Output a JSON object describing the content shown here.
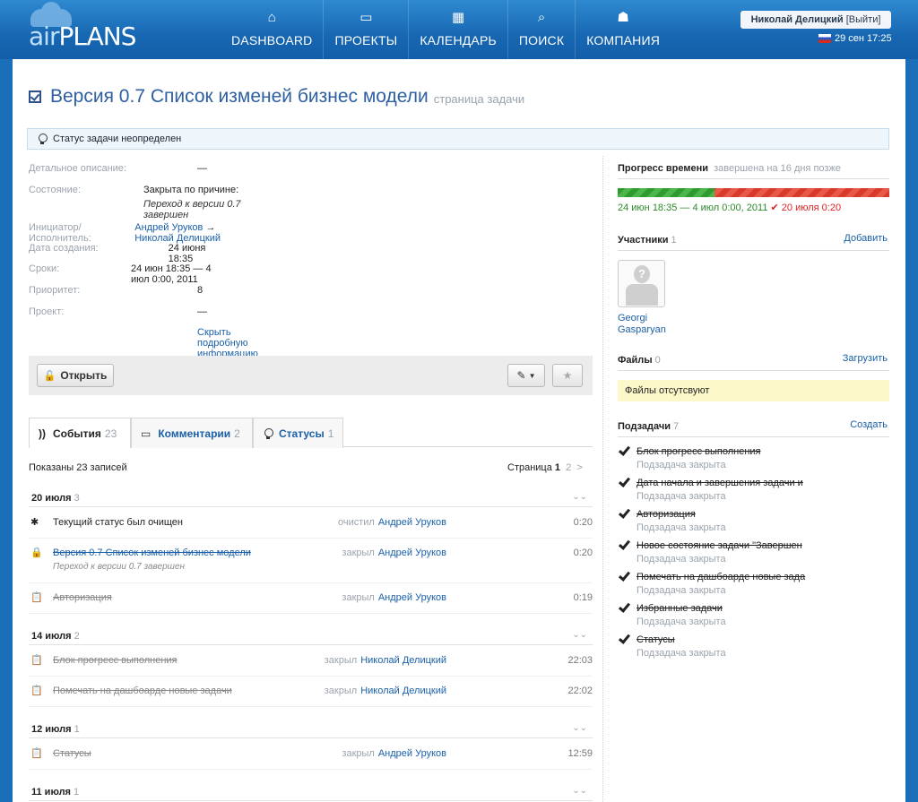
{
  "app": {
    "logo_air": "air",
    "logo_plans": "PLANS"
  },
  "nav": [
    {
      "label": "DASHBOARD",
      "icon": "home-icon"
    },
    {
      "label": "ПРОЕКТЫ",
      "icon": "monitor-icon"
    },
    {
      "label": "КАЛЕНДАРЬ",
      "icon": "calendar-icon"
    },
    {
      "label": "ПОИСК",
      "icon": "search-icon"
    },
    {
      "label": "КОМПАНИЯ",
      "icon": "people-icon"
    }
  ],
  "user": {
    "name": "Николай Делицкий",
    "logout": "[Выйти]",
    "datetime": "29 сен 17:25"
  },
  "task": {
    "title": "Версия 0.7 Список изменей бизнес модели",
    "subtitle": "страница задачи",
    "status": "Статус задачи неопределен"
  },
  "details": {
    "desc_label": "Детальное описание:",
    "desc_value": "—",
    "state_label": "Состояние:",
    "state_value": "Закрыта по причине:",
    "state_reason": "Переход к версии 0.7 завершен",
    "initiator_label": "Инициатор/Исполнитель:",
    "initiator": "Андрей Уруков",
    "arrow": "→",
    "executor": "Николай Делицкий",
    "created_label": "Дата создания:",
    "created_value": "24 июня 18:35",
    "terms_label": "Сроки:",
    "terms_value": "24 июн 18:35 — 4 июл 0:00, 2011",
    "priority_label": "Приоритет:",
    "priority_value": "8",
    "project_label": "Проект:",
    "project_value": "—",
    "hide_link": "Скрыть подробную информацию ↑"
  },
  "actions": {
    "open": "Открыть"
  },
  "tabs": [
    {
      "label": "События",
      "count": "23"
    },
    {
      "label": "Комментарии",
      "count": "2"
    },
    {
      "label": "Статусы",
      "count": "1"
    }
  ],
  "events": {
    "shown": "Показаны 23 записей",
    "page_label": "Страница",
    "page_current": "1",
    "page_next": "2",
    "page_arrow": ">",
    "groups": [
      {
        "date": "20 июля",
        "count": "3"
      },
      {
        "date": "14 июля",
        "count": "2"
      },
      {
        "date": "12 июля",
        "count": "1"
      },
      {
        "date": "11 июля",
        "count": "1"
      }
    ],
    "items": [
      {
        "text": "Текущий статус был очищен",
        "sub": "",
        "action": "очистил",
        "who": "Андрей Уруков",
        "time": "0:20"
      },
      {
        "text": "Версия 0.7 Список изменей бизнес модели",
        "sub": "Переход к версии 0.7 завершен",
        "action": "закрыл",
        "who": "Андрей Уруков",
        "time": "0:20"
      },
      {
        "text": "Авторизация",
        "sub": "",
        "action": "закрыл",
        "who": "Андрей Уруков",
        "time": "0:19"
      },
      {
        "text": "Блок прогресс выполнения",
        "sub": "",
        "action": "закрыл",
        "who": "Николай Делицкий",
        "time": "22:03"
      },
      {
        "text": "Помечать на дашбоарде новые задачи",
        "sub": "",
        "action": "закрыл",
        "who": "Николай Делицкий",
        "time": "22:02"
      },
      {
        "text": "Статусы",
        "sub": "",
        "action": "закрыл",
        "who": "Андрей Уруков",
        "time": "12:59"
      }
    ]
  },
  "right": {
    "time_title": "Прогресс времени",
    "time_note": "завершена на 16 дня позже",
    "time_range": "24 июн 18:35 — 4 июл 0:00, 2011",
    "time_done": "✔ 20 июля 0:20",
    "time_progress": 0.357,
    "participants_title": "Участники",
    "participants_count": "1",
    "participants_add": "Добавить",
    "participant_first": "Georgi",
    "participant_last": "Gasparyan",
    "files_title": "Файлы",
    "files_count": "0",
    "files_upload": "Загрузить",
    "files_empty": "Файлы отсутсвуют",
    "subtasks_title": "Подзадачи",
    "subtasks_count": "7",
    "subtasks_create": "Создать",
    "subtasks": [
      {
        "name": "Блок прогресс выполнения",
        "status": "Подзадача закрыта"
      },
      {
        "name": "Дата начала и завершения задачи и",
        "status": "Подзадача закрыта"
      },
      {
        "name": "Авторизация",
        "status": "Подзадача закрыта"
      },
      {
        "name": "Новое состояние задачи \"Завершен",
        "status": "Подзадача закрыта"
      },
      {
        "name": "Помечать на дашбоарде новые зада",
        "status": "Подзадача закрыта"
      },
      {
        "name": "Избранные задачи",
        "status": "Подзадача закрыта"
      },
      {
        "name": "Статусы",
        "status": "Подзадача закрыта"
      }
    ]
  },
  "colors": {
    "header": "#1767b3",
    "link": "#1a5fa8",
    "late": "#dd2222",
    "ontime": "#2a8b2a"
  }
}
